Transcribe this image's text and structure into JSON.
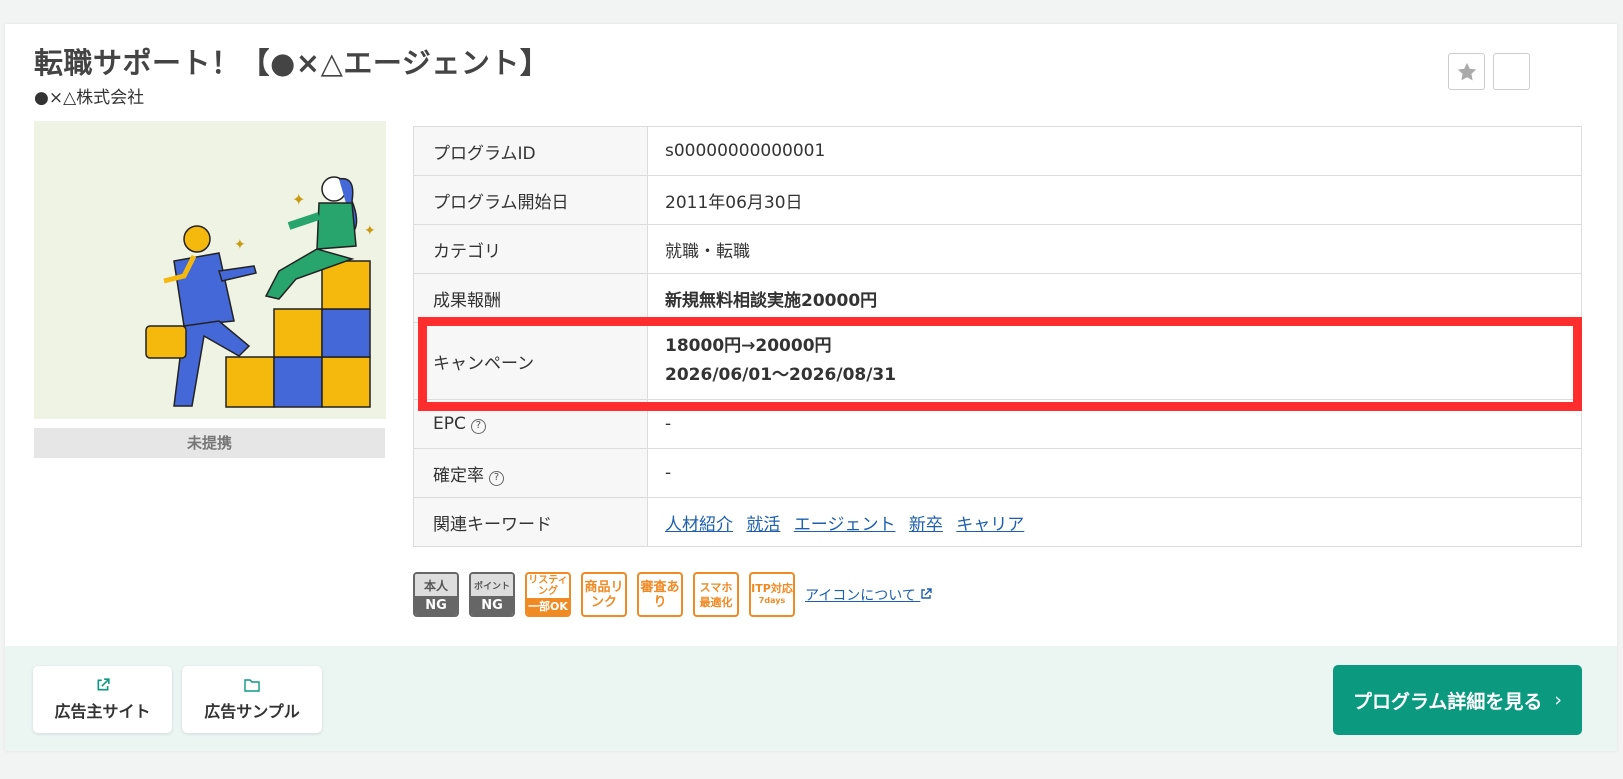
{
  "program": {
    "title": "転職サポート！【●×△エージェント】",
    "company": "●×△株式会社",
    "status": "未提携"
  },
  "details": {
    "program_id": {
      "label": "プログラムID",
      "value": "s00000000000001"
    },
    "start_date": {
      "label": "プログラム開始日",
      "value": "2011年06月30日"
    },
    "category": {
      "label": "カテゴリ",
      "value": "就職・転職"
    },
    "reward": {
      "label": "成果報酬",
      "value": "新規無料相談実施20000円"
    },
    "campaign": {
      "label": "キャンペーン",
      "line1": "18000円→20000円",
      "line2": "2026/06/01〜2026/08/31"
    },
    "epc": {
      "label": "EPC",
      "value": "-"
    },
    "confirm_rate": {
      "label": "確定率",
      "value": "-"
    },
    "keywords": {
      "label": "関連キーワード",
      "items": [
        "人材紹介",
        "就活",
        "エージェント",
        "新卒",
        "キャリア"
      ]
    }
  },
  "badges": {
    "self_top": "本人",
    "self_bottom": "NG",
    "point_top": "ポイント",
    "point_bottom": "NG",
    "listing_top": "リスティング",
    "listing_bottom": "一部OK",
    "product_link": "商品リンク",
    "review": "審査あり",
    "smartphone": "スマホ最適化",
    "itp": "ITP対応",
    "itp_days": "7days",
    "about_icons": "アイコンについて"
  },
  "footer": {
    "advertiser_site": "広告主サイト",
    "ad_sample": "広告サンプル",
    "detail_button": "プログラム詳細を見る",
    "detail_arrow": "›"
  },
  "help_glyph": "?",
  "colors": {
    "accent": "#0b9a80",
    "campaign_red": "#c0141b",
    "highlight_red": "#ff2d2d",
    "badge_orange": "#f08a24",
    "link_blue": "#1d5fae"
  }
}
